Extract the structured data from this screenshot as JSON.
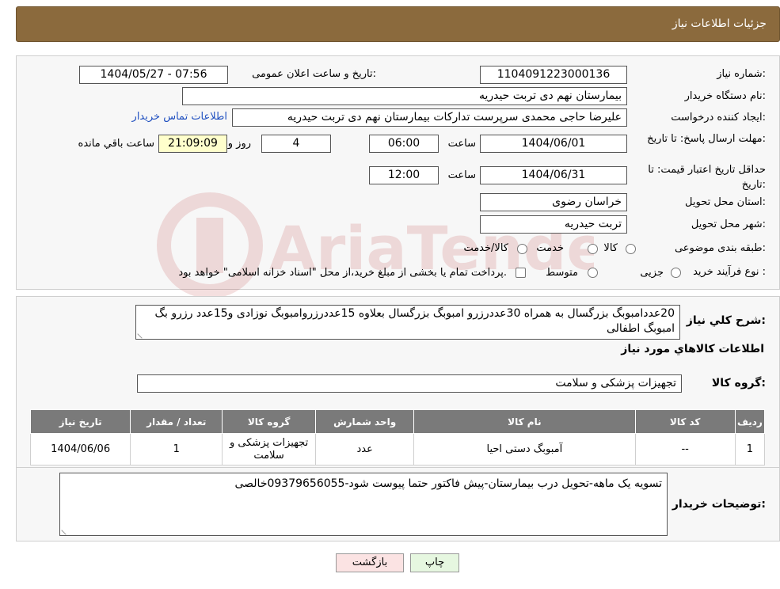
{
  "header": {
    "title": "جزئیات اطلاعات نیاز"
  },
  "form": {
    "need_number_label": "شماره نیاز:",
    "need_number": "1104091223000136",
    "announce_label": "تاریخ و ساعت اعلان عمومی:",
    "announce_value": "1404/05/27 - 07:56",
    "buyer_org_label": "نام دستگاه خریدار:",
    "buyer_org": "بیمارستان نهم دی تربت حیدریه",
    "creator_label": "ایجاد کننده درخواست:",
    "creator": "علیرضا حاجی محمدی سرپرست تدارکات بیمارستان نهم دی تربت حیدریه",
    "contact_link": "اطلاعات تماس خریدار",
    "deadline_label": "مهلت ارسال پاسخ: تا تاریخ:",
    "deadline_date": "1404/06/01",
    "time_label": "ساعت",
    "deadline_time": "06:00",
    "days_value": "4",
    "days_label": "روز و",
    "remaining_time": "21:09:09",
    "remaining_label": "ساعت باقي مانده",
    "validity_label": "حداقل تاریخ اعتبار قیمت: تا تاریخ:",
    "validity_date": "1404/06/31",
    "validity_time": "12:00",
    "province_label": "استان محل تحویل:",
    "province": "خراسان رضوی",
    "city_label": "شهر محل تحویل:",
    "city": "تربت حیدریه",
    "category_label": "طبقه بندی موضوعی:",
    "category_options": [
      "کالا",
      "خدمت",
      "کالا/خدمت"
    ],
    "process_label": "نوع فرآیند خرید :",
    "process_options": [
      "جزیی",
      "متوسط"
    ],
    "process_note": "پرداخت تمام یا بخشی از مبلغ خرید،از محل \"اسناد خزانه اسلامی\" خواهد بود."
  },
  "summary": {
    "desc_label": "شرح کلي نياز:",
    "desc_text": "20عددامبوبگ بزرگسال به همراه 30عددرزرو امبوبگ بزرگسال بعلاوه 15عددرزروامبوبگ نوزادی و15عدد رزرو بگ امبوبگ اطفالی",
    "goods_info_title": "اطلاعات کالاهاي مورد نياز",
    "goods_group_label": "گروه کالا:",
    "goods_group": "تجهیزات پزشکی و سلامت"
  },
  "table": {
    "headers": [
      "رديف",
      "کد کالا",
      "نام کالا",
      "واحد شمارش",
      "گروه کالا",
      "تعداد / مقدار",
      "تاريخ نياز"
    ],
    "rows": [
      [
        "1",
        "--",
        "آمبوبگ دستی احیا",
        "عدد",
        "تجهیزات پزشکی و سلامت",
        "1",
        "1404/06/06"
      ]
    ]
  },
  "buyer_notes": {
    "label": "توضیحات خریدار:",
    "text": "تسویه یک ماهه-تحویل درب بیمارستان-پیش فاکتور حتما پیوست شود-09379656055خالصی"
  },
  "buttons": {
    "print": "چاپ",
    "back": "بازگشت"
  },
  "watermark": "AriaTender.neT",
  "colors": {
    "header_bg": "#8b6a3d",
    "table_header_bg": "#7a7a7a",
    "remaining_bg": "#ffffcc",
    "back_btn_bg": "#fbe3e3",
    "print_btn_bg": "#e6f7e0"
  }
}
